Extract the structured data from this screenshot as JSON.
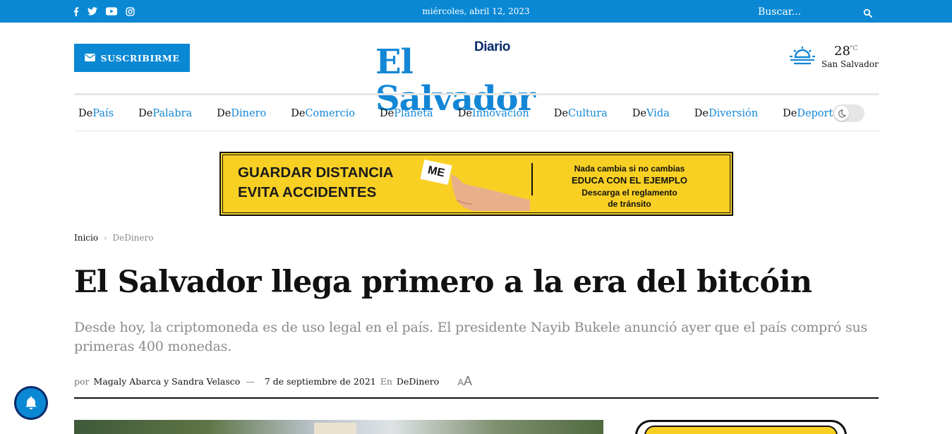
{
  "topbar": {
    "social_icons": [
      "facebook-icon",
      "twitter-icon",
      "youtube-icon",
      "instagram-icon"
    ],
    "date": "miércoles, abril 12, 2023",
    "search_placeholder": "Buscar..."
  },
  "header": {
    "subscribe_label": "SUSCRIBIRME",
    "logo_top": "Diario",
    "logo_main": "El Salvador",
    "weather": {
      "temperature": "28",
      "unit": "°C",
      "city": "San Salvador"
    }
  },
  "nav": {
    "items": [
      {
        "prefix": "De",
        "label": "País"
      },
      {
        "prefix": "De",
        "label": "Palabra"
      },
      {
        "prefix": "De",
        "label": "Dinero"
      },
      {
        "prefix": "De",
        "label": "Comercio"
      },
      {
        "prefix": "De",
        "label": "Planeta"
      },
      {
        "prefix": "De",
        "label": "Innovación"
      },
      {
        "prefix": "De",
        "label": "Cultura"
      },
      {
        "prefix": "De",
        "label": "Vida"
      },
      {
        "prefix": "De",
        "label": "Diversión"
      },
      {
        "prefix": "De",
        "label": "Deportes"
      }
    ]
  },
  "ad": {
    "line1": "GUARDAR DISTANCIA",
    "card": "ME",
    "line2": "EVITA ACCIDENTES",
    "right1": "Nada cambia si no cambias",
    "right2": "EDUCA CON EL EJEMPLO",
    "right3": "Descarga el  reglamento",
    "right4": "de tránsito"
  },
  "breadcrumb": {
    "home": "Inicio",
    "current": "DeDinero"
  },
  "article": {
    "title": "El Salvador llega primero a la era del bitcóin",
    "dek": "Desde hoy, la criptomoneda es de uso legal en el país. El presidente Nayib Bukele anunció ayer que el país compró sus primeras 400 monedas.",
    "meta": {
      "by": "por",
      "authors": "Magaly Abarca y Sandra Velasco",
      "dash": "—",
      "date": "7 de septiembre de 2021",
      "in_label": "En",
      "category": "DeDinero",
      "font_small": "A",
      "font_big": "A"
    }
  },
  "colors": {
    "brand_blue": "#0a88d3",
    "logo_navy": "#0b2b6b",
    "ad_yellow": "#f8d024"
  }
}
